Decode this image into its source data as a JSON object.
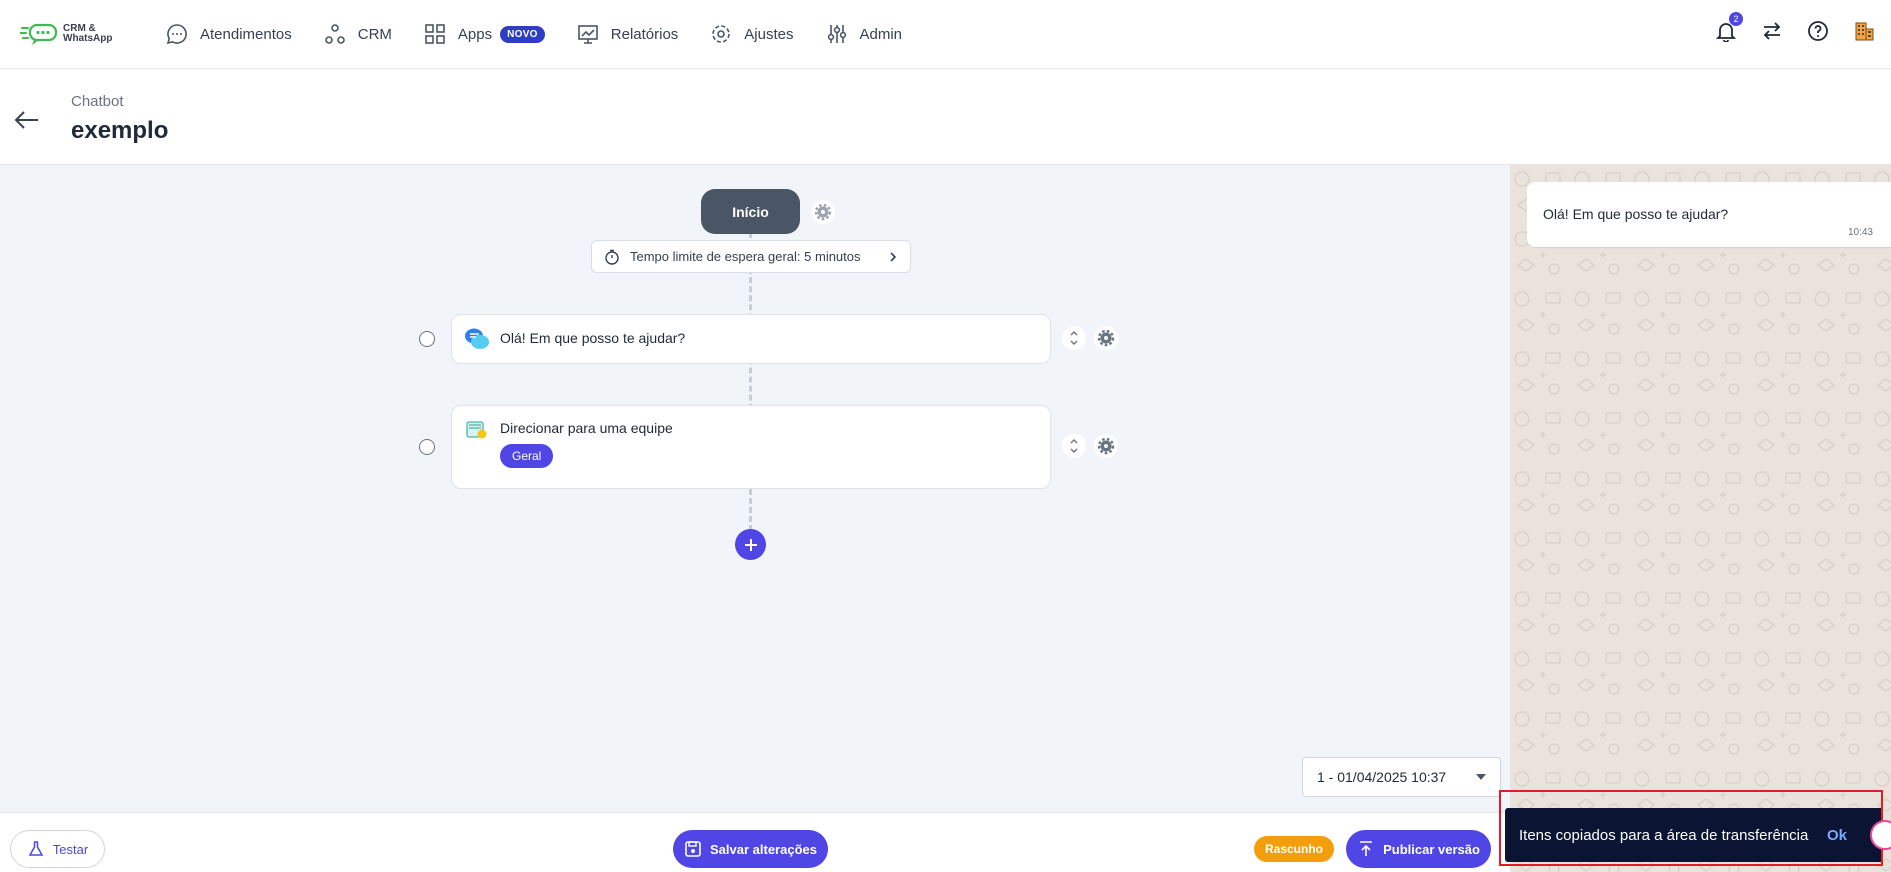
{
  "app": {
    "logo_line1": "CRM &",
    "logo_line2": "WhatsApp"
  },
  "nav": {
    "items": [
      {
        "label": "Atendimentos",
        "icon": "chat-bubble-icon"
      },
      {
        "label": "CRM",
        "icon": "crm-nodes-icon"
      },
      {
        "label": "Apps",
        "icon": "apps-grid-icon",
        "badge": "NOVO"
      },
      {
        "label": "Relatórios",
        "icon": "chart-icon"
      },
      {
        "label": "Ajustes",
        "icon": "gear-icon"
      },
      {
        "label": "Admin",
        "icon": "sliders-icon"
      }
    ],
    "notification_count": "2"
  },
  "header": {
    "breadcrumb": "Chatbot",
    "title": "exemplo"
  },
  "flow": {
    "start_label": "Início",
    "timeout_text": "Tempo limite de espera geral: 5 minutos",
    "steps": [
      {
        "title": "Olá! Em que posso te ajudar?",
        "icon": "message-bubbles-icon"
      },
      {
        "title": "Direcionar para uma equipe",
        "tag": "Geral",
        "icon": "team-folder-icon"
      }
    ]
  },
  "version": {
    "selected": "1 - 01/04/2025 10:37"
  },
  "preview": {
    "message": "Olá! Em que posso te ajudar?",
    "time": "10:43"
  },
  "bottom": {
    "test_label": "Testar",
    "save_label": "Salvar alterações",
    "status_badge": "Rascunho",
    "publish_label": "Publicar versão"
  },
  "snackbar": {
    "message": "Itens copiados para a área de transferência",
    "action": "Ok"
  },
  "colors": {
    "accent": "#4f46e5",
    "start_node": "#4a5565",
    "draft": "#f59e0b",
    "snackbar": "#0b1533",
    "highlight": "#e11d2a"
  }
}
